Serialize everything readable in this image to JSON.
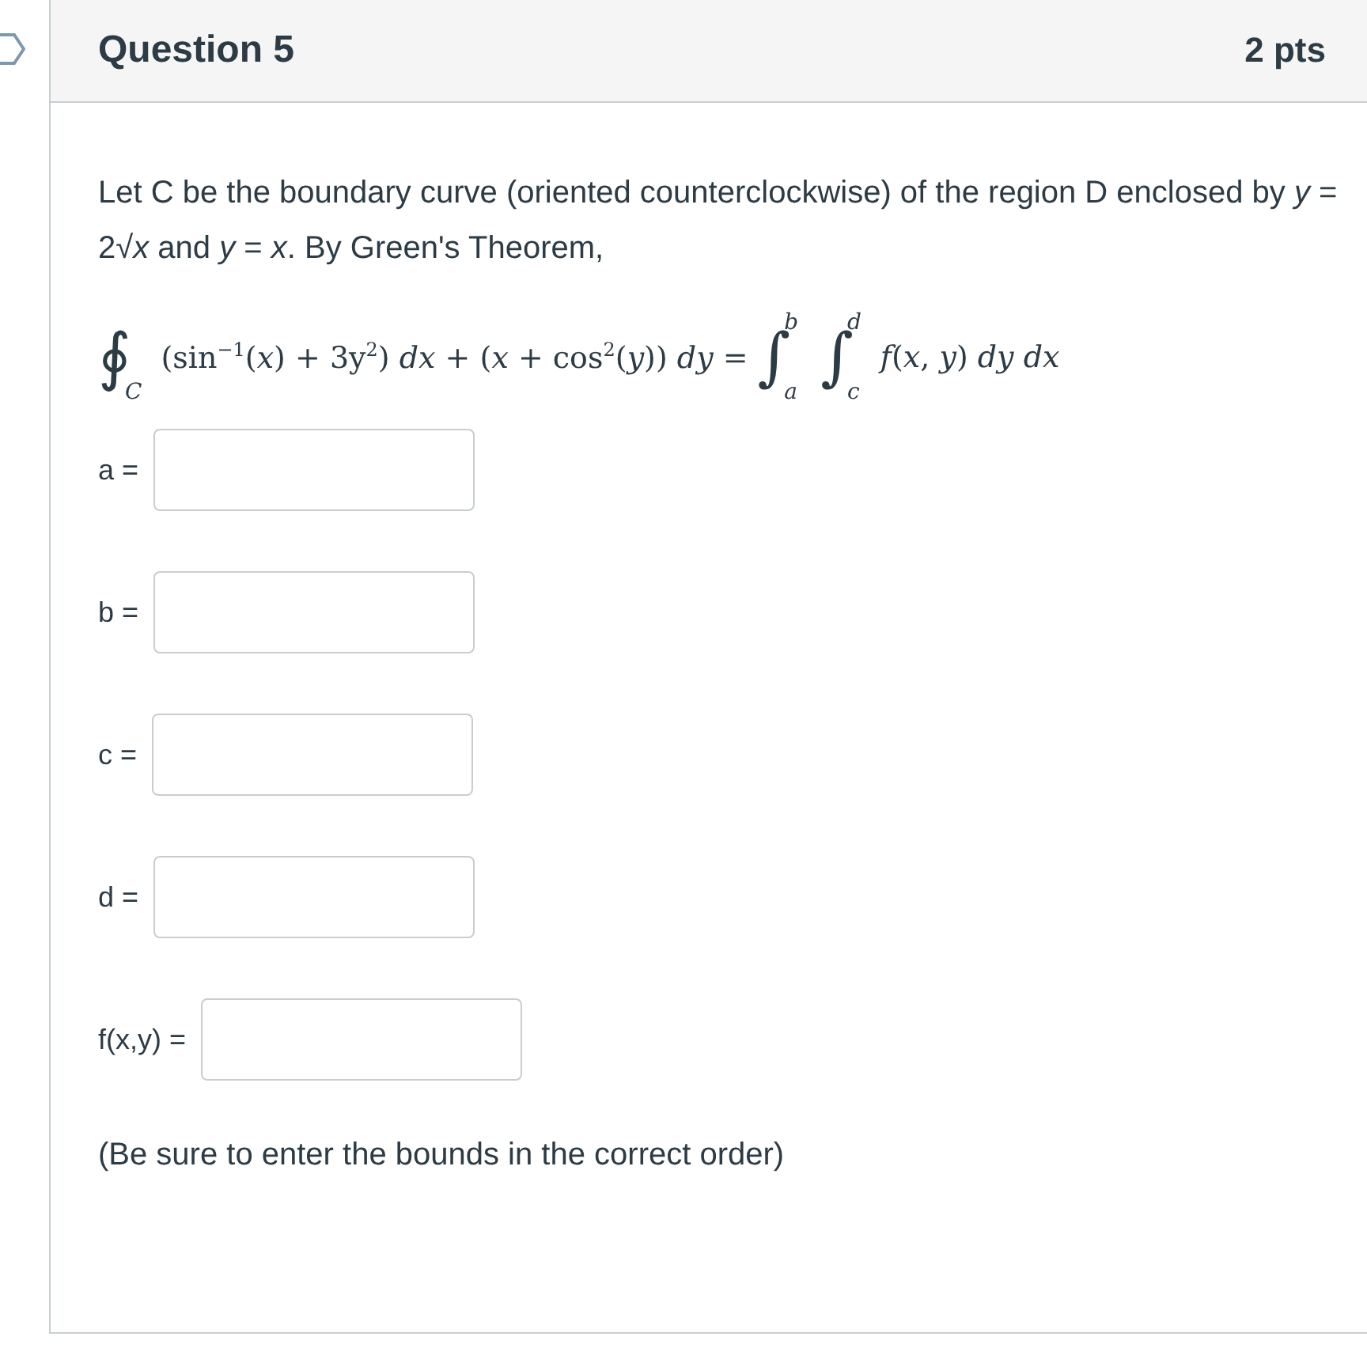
{
  "question": {
    "title": "Question 5",
    "points": "2 pts"
  },
  "prompt": "Let C be the boundary curve (oriented counterclockwise) of the region D enclosed by *y* = 2√*x* and *y* = *x*.  By Green's Theorem,",
  "formula": {
    "contour": {
      "sign": "∮",
      "lower": "C"
    },
    "integrand": "(sin$^{−1}$(*x*) + 3y$^{2}$) *dx* + (*x* + cos$^{2}$(*y*)) *dy* =",
    "integrals": [
      {
        "sign": "∫",
        "lower": "a",
        "upper": "b"
      },
      {
        "sign": "∫",
        "lower": "c",
        "upper": "d"
      }
    ],
    "tail": "*f*(*x*, *y*) *dy* *dx*"
  },
  "answers": [
    {
      "label": "a ="
    },
    {
      "label": "b ="
    },
    {
      "label": "c ="
    },
    {
      "label": "d ="
    },
    {
      "label": "f(x,y) ="
    }
  ],
  "note": "(Be sure to enter the bounds in the correct order)"
}
